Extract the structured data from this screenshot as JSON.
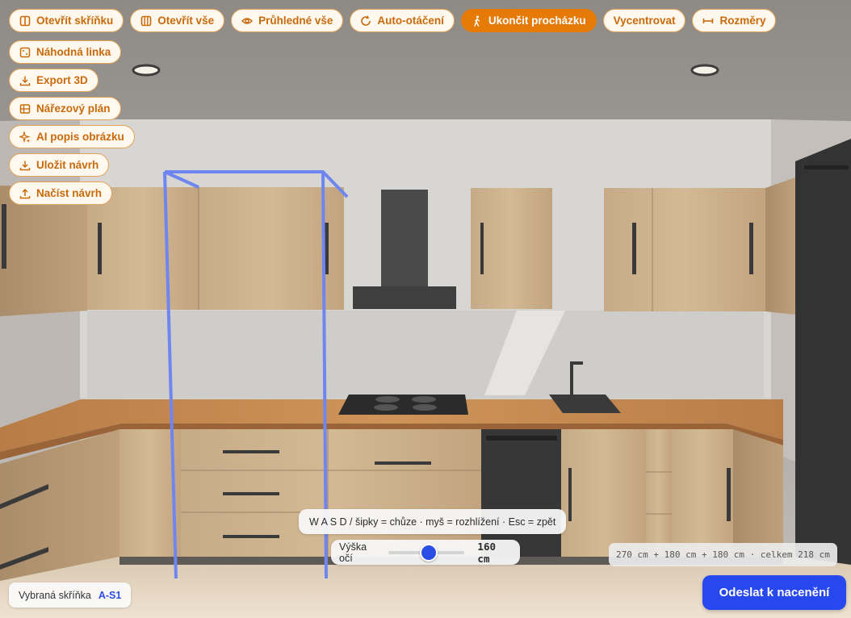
{
  "toolbar": {
    "row": [
      {
        "label": "Otevřít skříňku",
        "icon": "columns-icon",
        "active": false
      },
      {
        "label": "Otevřít vše",
        "icon": "multi-columns-icon",
        "active": false
      },
      {
        "label": "Průhledné vše",
        "icon": "eye-icon",
        "active": false
      },
      {
        "label": "Auto-otáčení",
        "icon": "rotate-icon",
        "active": false
      },
      {
        "label": "Ukončit procházku",
        "icon": "walk-icon",
        "active": true
      },
      {
        "label": "Vycentrovat",
        "icon": "",
        "active": false
      },
      {
        "label": "Rozměry",
        "icon": "ruler-icon",
        "active": false
      }
    ],
    "column": [
      {
        "label": "Náhodná linka",
        "icon": "dice-icon"
      },
      {
        "label": "Export 3D",
        "icon": "download-icon"
      },
      {
        "label": "Nářezový plán",
        "icon": "grid-icon"
      },
      {
        "label": "AI popis obrázku",
        "icon": "sparkle-icon"
      },
      {
        "label": "Uložit návrh",
        "icon": "download-icon"
      },
      {
        "label": "Načíst návrh",
        "icon": "upload-icon"
      }
    ]
  },
  "controls_hint": "W A S D / šipky = chůze · myš = rozhlížení · Esc = zpět",
  "eye_height": {
    "label": "Výška očí",
    "value": "160 cm",
    "level": 0.5
  },
  "dimensions": "270 cm + 180 cm + 180 cm · celkem 218 cm",
  "selected": {
    "label": "Vybraná skříňka",
    "code": "A-S1"
  },
  "submit_label": "Odeslat k nacenění",
  "colors": {
    "accent_orange": "#e57a07",
    "accent_blue": "#2748ee",
    "wood": "#c9ad8b",
    "countertop": "#c58a52"
  }
}
